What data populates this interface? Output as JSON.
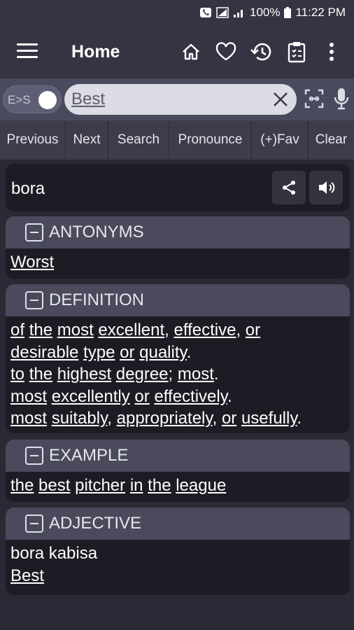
{
  "status_bar": {
    "battery": "100%",
    "time": "11:22 PM"
  },
  "app_bar": {
    "title": "Home"
  },
  "search": {
    "toggle_label": "E>S",
    "query": "Best"
  },
  "toolbar": [
    "Previous",
    "Next",
    "Search",
    "Pronounce",
    "(+)Fav",
    "Clear"
  ],
  "result": {
    "word": "bora"
  },
  "sections": {
    "antonyms": {
      "title": "ANTONYMS",
      "lines": [
        [
          "Worst"
        ]
      ]
    },
    "definition": {
      "title": "DEFINITION",
      "lines": [
        [
          "of",
          "the",
          "most",
          "excellent",
          ",",
          "effective",
          ",",
          "or"
        ],
        [
          "desirable",
          "type",
          "or",
          "quality",
          "."
        ],
        [
          "to",
          "the",
          "highest",
          "degree",
          ";",
          "most",
          "."
        ],
        [
          "most",
          "excellently",
          "or",
          "effectively",
          "."
        ],
        [
          "most",
          "suitably",
          ",",
          "appropriately",
          ",",
          "or",
          "usefully",
          "."
        ]
      ]
    },
    "example": {
      "title": "EXAMPLE",
      "lines": [
        [
          "the",
          "best",
          "pitcher",
          "in",
          "the",
          "league"
        ]
      ]
    },
    "adjective": {
      "title": "ADJECTIVE",
      "text": "bora kabisa",
      "lines": [
        [
          "Best"
        ]
      ]
    }
  }
}
